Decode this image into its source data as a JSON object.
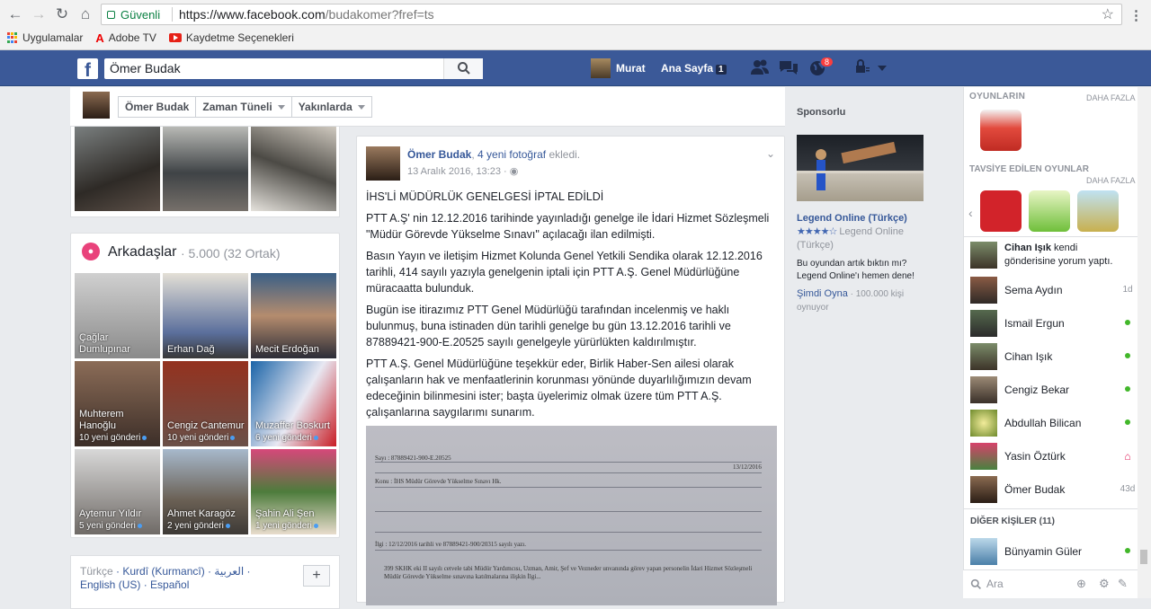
{
  "browser": {
    "secure_label": "Güvenli",
    "url_host": "https://www.facebook.com",
    "url_path": "/budakomer?fref=ts",
    "bookmarks": [
      "Uygulamalar",
      "Adobe TV",
      "Kaydetme Seçenekleri"
    ]
  },
  "fb": {
    "search_value": "Ömer Budak",
    "user_name": "Murat",
    "home_label": "Ana Sayfa",
    "home_count": "1",
    "notif_count": "8"
  },
  "profile_tabs": [
    "Ömer Budak",
    "Zaman Tüneli",
    "Yakınlarda"
  ],
  "friends": {
    "title": "Arkadaşlar",
    "count": "· 5.000 (32 Ortak)",
    "items": [
      {
        "name": "Çağlar Dumlupınar",
        "sub": ""
      },
      {
        "name": "Erhan Dağ",
        "sub": ""
      },
      {
        "name": "Mecit Erdoğan",
        "sub": ""
      },
      {
        "name": "Muhterem Hanoğlu",
        "sub": "10 yeni gönderi"
      },
      {
        "name": "Cengiz Cantemur",
        "sub": "10 yeni gönderi"
      },
      {
        "name": "Muzaffer Boskurt",
        "sub": "6 yeni gönderi"
      },
      {
        "name": "Aytemur Yıldır",
        "sub": "5 yeni gönderi"
      },
      {
        "name": "Ahmet Karagöz",
        "sub": "2 yeni gönderi"
      },
      {
        "name": "Şahin Ali Şen",
        "sub": "1 yeni gönderi"
      }
    ]
  },
  "languages": {
    "line1_first": "Türkçe",
    "line1_rest": "· Kurdî (Kurmancî) · العربية ·",
    "line2": "English (US) · Español",
    "plus": "+"
  },
  "post": {
    "author": "Ömer Budak",
    "action_pre": ",",
    "action_link": "4 yeni fotoğraf",
    "action_post": "ekledi.",
    "time": "13 Aralık 2016, 13:23 ·",
    "paragraphs": [
      "İHS'Lİ MÜDÜRLÜK GENELGESİ İPTAL EDİLDİ",
      "PTT A.Ş' nin 12.12.2016 tarihinde yayınladığı genelge ile İdari Hizmet Sözleşmeli \"Müdür Görevde Yükselme Sınavı\" açılacağı ilan edilmişti.",
      "Basın Yayın ve iletişim Hizmet Kolunda Genel Yetkili Sendika olarak 12.12.2016 tarihli, 414 sayılı yazıyla genelgenin iptali için PTT A.Ş. Genel Müdürlüğüne müracaatta bulunduk.",
      "Bugün ise itirazımız PTT Genel Müdürlüğü tarafından incelenmiş ve haklı bulunmuş, buna istinaden dün tarihli genelge bu gün 13.12.2016 tarihli ve 87889421-900-E.20525 sayılı genelgeyle yürürlükten kaldırılmıştır.",
      "PTT A.Ş. Genel Müdürlüğüne teşekkür eder, Birlik Haber-Sen ailesi olarak çalışanların hak ve menfaatlerinin korunması yönünde duyarlılığımızın devam edeceğinin bilinmesini ister; başta üyelerimiz olmak üzere tüm PTT A.Ş. çalışanlarına saygılarımı sunarım."
    ],
    "doc": {
      "sayi": "Sayı : 87889421-900-E.20525",
      "date": "13/12/2016",
      "konu": "Konu : İHS Müdür Görevde Yükselme Sınavı Hk.",
      "ilgi": "İlgi : 12/12/2016 tarihli ve 87889421-900/20315 sayılı yazı.",
      "body": "399 SKHK eki II sayılı cetvele tabi Müdür Yardımcısı, Uzman, Amir, Şef ve Vezneder unvanında görev yapan personelin İdari Hizmet Sözleşmeli Müdür Görevde Yükselme sınavına katılmalarına ilişkin İlgi..."
    }
  },
  "sponsor": {
    "title": "Sponsorlu",
    "name": "Legend Online (Türkçe)",
    "stars": "★★★★☆",
    "rating_text": "Legend Online (Türkçe)",
    "desc": "Bu oyundan artık bıktın mı? Legend Online'ı hemen dene!",
    "cta": "Şimdi Oyna",
    "players": "· 100.000 kişi oynuyor"
  },
  "sidebar": {
    "games_title": "OYUNLARIN",
    "more1": "DAHA FAZLA",
    "rec_title": "TAVSİYE EDİLEN OYUNLAR",
    "more2": "DAHA FAZLA",
    "activity_name": "Cihan Işık",
    "activity_text": "kendi gönderisine yorum yaptı.",
    "contacts": [
      {
        "name": "Sema Aydın",
        "status": "1d",
        "online": false
      },
      {
        "name": "Ismail Ergun",
        "status": "",
        "online": true
      },
      {
        "name": "Cihan Işık",
        "status": "",
        "online": true
      },
      {
        "name": "Cengiz Bekar",
        "status": "",
        "online": true
      },
      {
        "name": "Abdullah Bilican",
        "status": "",
        "online": true
      },
      {
        "name": "Yasin Öztürk",
        "status": "",
        "online": false
      },
      {
        "name": "Ömer Budak",
        "status": "43d",
        "online": false
      }
    ],
    "other_title": "DİĞER KİŞİLER (11)",
    "other_contacts": [
      {
        "name": "Bünyamin Güler",
        "status": "",
        "online": true
      }
    ],
    "search_placeholder": "Ara"
  },
  "colors": {
    "fb_blue": "#3b5998",
    "link": "#365899",
    "online": "#42b72a"
  }
}
